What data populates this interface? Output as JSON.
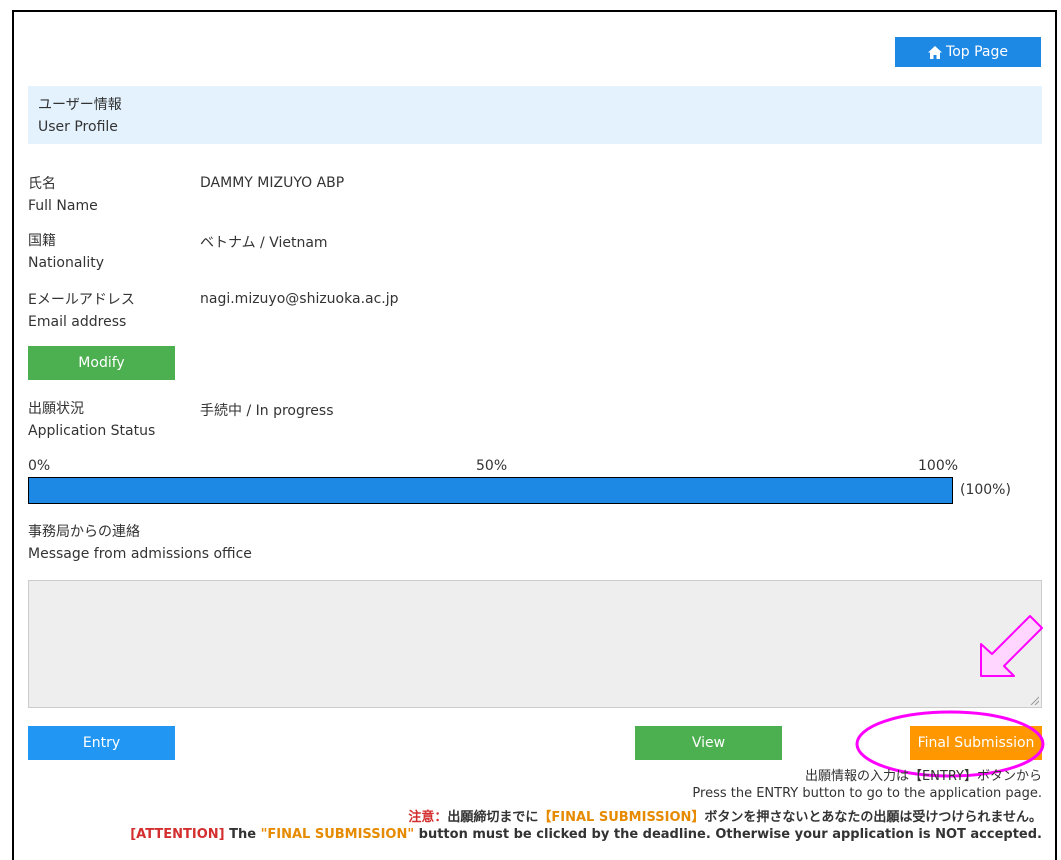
{
  "header": {
    "top_page_label": "Top Page"
  },
  "profile": {
    "title_ja": "ユーザー情報",
    "title_en": "User Profile",
    "fields": [
      {
        "label_ja": "氏名",
        "label_en": "Full Name",
        "value": "DAMMY MIZUYO ABP"
      },
      {
        "label_ja": "国籍",
        "label_en": "Nationality",
        "value": "ベトナム / Vietnam"
      },
      {
        "label_ja": "Eメールアドレス",
        "label_en": "Email address",
        "value": "nagi.mizuyo@shizuoka.ac.jp"
      }
    ],
    "modify_label": "Modify"
  },
  "status": {
    "label_ja": "出願状況",
    "label_en": "Application Status",
    "value": "手続中 / In progress"
  },
  "progress": {
    "tick_0": "0%",
    "tick_50": "50%",
    "tick_100": "100%",
    "percent_text": "(100%)",
    "fraction": 1.0
  },
  "message": {
    "label_ja": "事務局からの連絡",
    "label_en": "Message from admissions office",
    "body": ""
  },
  "actions": {
    "entry_label": "Entry",
    "view_label": "View",
    "final_label": "Final Submission"
  },
  "notes": {
    "line1": "出願情報の入力は【ENTRY】ボタンから",
    "line2": "Press the ENTRY button to go to the application page.",
    "line3_prefix": "注意：",
    "line3_mid1": "出願締切までに",
    "line3_highlight": "【FINAL SUBMISSION】",
    "line3_suffix": "ボタンを押さないとあなたの出願は受けつけられません。",
    "line4_prefix": "[ATTENTION]",
    "line4_mid": " The ",
    "line4_highlight": "\"FINAL SUBMISSION\"",
    "line4_suffix": " button must be clicked by the deadline. Otherwise your application is NOT accepted."
  },
  "colors": {
    "primary_blue": "#1e88e5",
    "green": "#4caf50",
    "orange": "#ff9800",
    "highlight_magenta": "#ff00ff",
    "attention_red": "#d32f2f"
  }
}
